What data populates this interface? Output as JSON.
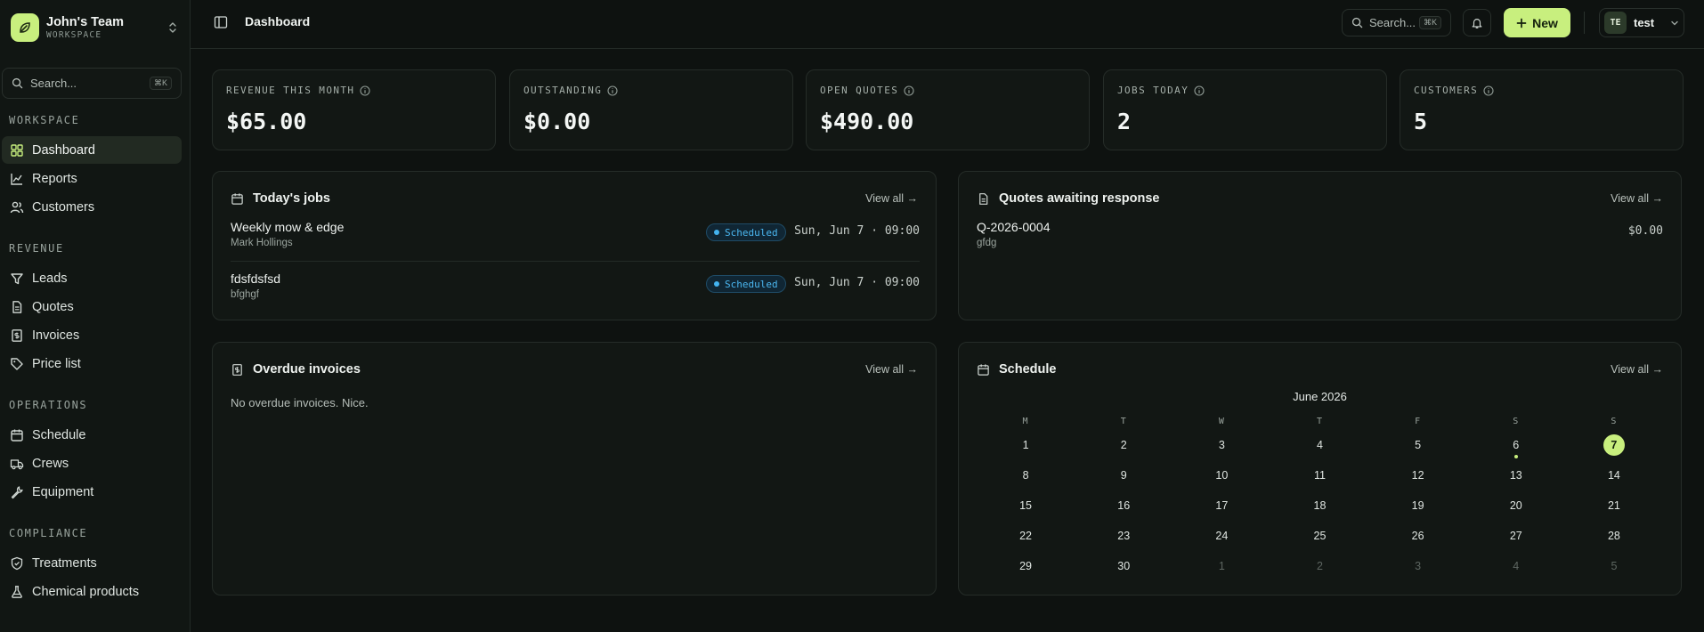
{
  "team": {
    "name": "John's Team",
    "subtitle": "WORKSPACE"
  },
  "sidebar": {
    "search_placeholder": "Search...",
    "search_shortcut": "⌘K",
    "sections": [
      {
        "label": "WORKSPACE",
        "items": [
          {
            "label": "Dashboard",
            "icon": "dashboard-icon",
            "active": true
          },
          {
            "label": "Reports",
            "icon": "chart-line-icon"
          },
          {
            "label": "Customers",
            "icon": "users-icon"
          }
        ]
      },
      {
        "label": "REVENUE",
        "items": [
          {
            "label": "Leads",
            "icon": "funnel-icon"
          },
          {
            "label": "Quotes",
            "icon": "document-icon"
          },
          {
            "label": "Invoices",
            "icon": "invoice-icon"
          },
          {
            "label": "Price list",
            "icon": "tag-icon"
          }
        ]
      },
      {
        "label": "OPERATIONS",
        "items": [
          {
            "label": "Schedule",
            "icon": "calendar-icon"
          },
          {
            "label": "Crews",
            "icon": "truck-icon"
          },
          {
            "label": "Equipment",
            "icon": "wrench-icon"
          }
        ]
      },
      {
        "label": "COMPLIANCE",
        "items": [
          {
            "label": "Treatments",
            "icon": "shield-icon"
          },
          {
            "label": "Chemical products",
            "icon": "flask-icon"
          }
        ]
      }
    ]
  },
  "header": {
    "breadcrumb": "Dashboard",
    "search_placeholder": "Search...",
    "search_shortcut": "⌘K",
    "new_label": "New",
    "user_initials": "TE",
    "user_name": "test"
  },
  "stats": [
    {
      "label": "REVENUE THIS MONTH",
      "value": "$65.00"
    },
    {
      "label": "OUTSTANDING",
      "value": "$0.00"
    },
    {
      "label": "OPEN QUOTES",
      "value": "$490.00"
    },
    {
      "label": "JOBS TODAY",
      "value": "2"
    },
    {
      "label": "CUSTOMERS",
      "value": "5"
    }
  ],
  "todays_jobs": {
    "title": "Today's jobs",
    "view_all": "View all →",
    "jobs": [
      {
        "title": "Weekly mow & edge",
        "customer": "Mark Hollings",
        "status": "Scheduled",
        "time": "Sun, Jun 7 · 09:00"
      },
      {
        "title": "fdsfdsfsd",
        "customer": "bfghgf",
        "status": "Scheduled",
        "time": "Sun, Jun 7 · 09:00"
      }
    ]
  },
  "quotes": {
    "title": "Quotes awaiting response",
    "view_all": "View all →",
    "items": [
      {
        "id": "Q-2026-0004",
        "customer": "gfdg",
        "amount": "$0.00"
      }
    ]
  },
  "overdue": {
    "title": "Overdue invoices",
    "view_all": "View all →",
    "empty": "No overdue invoices. Nice."
  },
  "schedule": {
    "title": "Schedule",
    "view_all": "View all →",
    "month": "June 2026",
    "weekdays": [
      "M",
      "T",
      "W",
      "T",
      "F",
      "S",
      "S"
    ],
    "weeks": [
      [
        "1",
        "2",
        "3",
        "4",
        "5",
        "6",
        "7"
      ],
      [
        "8",
        "9",
        "10",
        "11",
        "12",
        "13",
        "14"
      ],
      [
        "15",
        "16",
        "17",
        "18",
        "19",
        "20",
        "21"
      ],
      [
        "22",
        "23",
        "24",
        "25",
        "26",
        "27",
        "28"
      ],
      [
        "29",
        "30",
        "1",
        "2",
        "3",
        "4",
        "5"
      ]
    ],
    "today": "7",
    "event_days": [
      "6"
    ],
    "colors": {
      "accent": "#c8ef7e",
      "status_blue": "#43b4f1"
    }
  }
}
